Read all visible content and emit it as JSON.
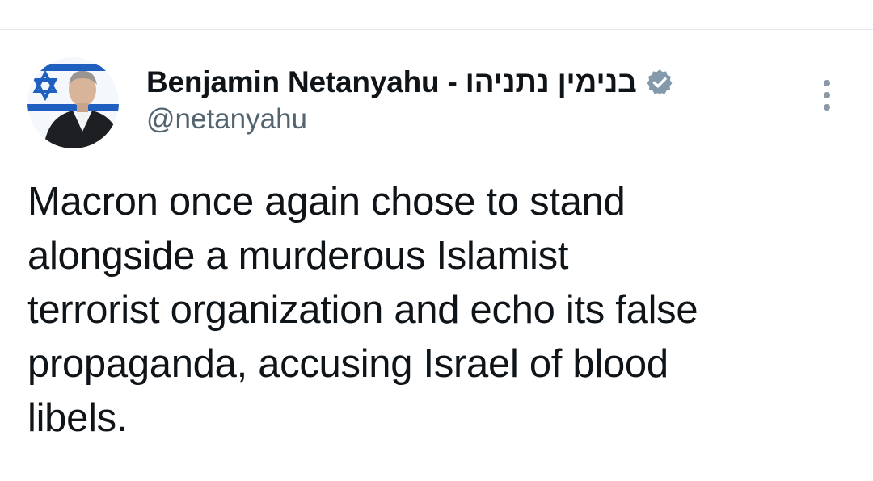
{
  "tweet": {
    "author": {
      "display_name": "Benjamin Netanyahu - בנימין נתניהו",
      "handle": "@netanyahu",
      "verified": true,
      "avatar": "profile photo in front of Israeli flag"
    },
    "text_lines": [
      "Macron once again chose to stand",
      "alongside a murderous Islamist",
      "terrorist organization and echo its false",
      "propaganda, accusing Israel of blood",
      "libels."
    ],
    "more_icon": "more-vertical-icon",
    "verified_icon": "verified-badge-icon"
  },
  "colors": {
    "text_primary": "#0f1419",
    "text_secondary": "#536471",
    "badge": "#829aab",
    "divider": "#e6e8ea",
    "flag_blue": "#1f5fbf"
  }
}
